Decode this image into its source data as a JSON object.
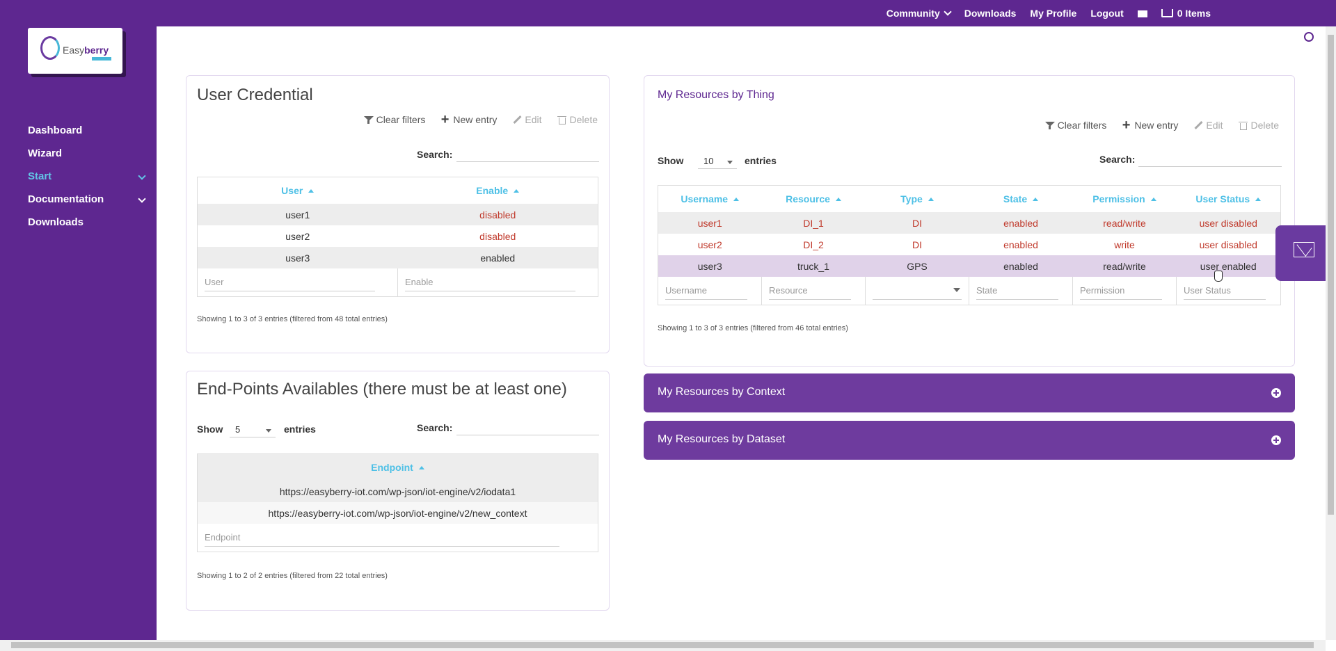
{
  "topnav": {
    "community": "Community",
    "downloads": "Downloads",
    "profile": "My Profile",
    "logout": "Logout",
    "cart": "0 Items"
  },
  "logo": {
    "part1": "Easy",
    "part2": "berry"
  },
  "sidebar": {
    "items": [
      {
        "label": "Dashboard"
      },
      {
        "label": "Wizard"
      },
      {
        "label": "Start"
      },
      {
        "label": "Documentation"
      },
      {
        "label": "Downloads"
      }
    ]
  },
  "toolbar": {
    "clear": "Clear filters",
    "new": "New entry",
    "edit": "Edit",
    "delete": "Delete"
  },
  "credential": {
    "title": "User Credential",
    "search_label": "Search:",
    "columns": [
      "User",
      "Enable"
    ],
    "rows": [
      {
        "user": "user1",
        "enable": "disabled"
      },
      {
        "user": "user2",
        "enable": "disabled"
      },
      {
        "user": "user3",
        "enable": "enabled"
      }
    ],
    "filters": [
      "User",
      "Enable"
    ],
    "info": "Showing 1 to 3 of 3 entries (filtered from 48 total entries)"
  },
  "endpoints": {
    "title": "End-Points Availables (there must be at least one)",
    "show": "Show",
    "entries": "entries",
    "page_len": "5",
    "search_label": "Search:",
    "column": "Endpoint",
    "rows": [
      "https://easyberry-iot.com/wp-json/iot-engine/v2/iodata1",
      "https://easyberry-iot.com/wp-json/iot-engine/v2/new_context"
    ],
    "filter": "Endpoint",
    "info": "Showing 1 to 2 of 2 entries (filtered from 22 total entries)"
  },
  "thing": {
    "title": "My Resources by Thing",
    "show": "Show",
    "entries": "entries",
    "page_len": "10",
    "search_label": "Search:",
    "columns": [
      "Username",
      "Resource",
      "Type",
      "State",
      "Permission",
      "User Status"
    ],
    "rows": [
      {
        "username": "user1",
        "resource": "DI_1",
        "type": "DI",
        "state": "enabled",
        "permission": "read/write",
        "status": "user disabled"
      },
      {
        "username": "user2",
        "resource": "DI_2",
        "type": "DI",
        "state": "enabled",
        "permission": "write",
        "status": "user disabled"
      },
      {
        "username": "user3",
        "resource": "truck_1",
        "type": "GPS",
        "state": "enabled",
        "permission": "read/write",
        "status": "user enabled"
      }
    ],
    "filters": [
      "Username",
      "Resource",
      "",
      "State",
      "Permission",
      "User Status"
    ],
    "info": "Showing 1 to 3 of 3 entries (filtered from 46 total entries)"
  },
  "accordions": {
    "context": "My Resources by Context",
    "dataset": "My Resources by Dataset"
  },
  "colors": {
    "brand": "#5e2790",
    "accent": "#4ec0e6",
    "danger": "#c0392b"
  }
}
